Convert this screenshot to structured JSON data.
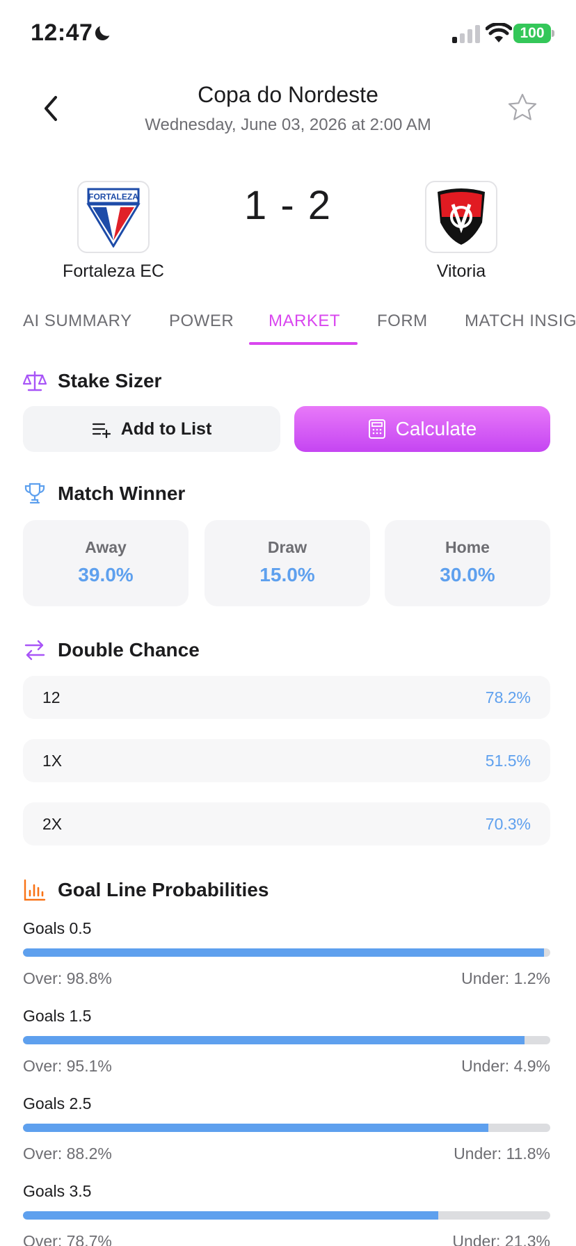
{
  "status_bar": {
    "time": "12:47",
    "battery": "100"
  },
  "header": {
    "title": "Copa do Nordeste",
    "subtitle": "Wednesday, June 03, 2026 at 2:00 AM"
  },
  "match": {
    "home_team": "Fortaleza EC",
    "home_logo_text": "FORTALEZA",
    "away_team": "Vitoria",
    "score": "1 - 2"
  },
  "tabs": [
    {
      "label": "AI SUMMARY"
    },
    {
      "label": "POWER"
    },
    {
      "label": "MARKET"
    },
    {
      "label": "FORM"
    },
    {
      "label": "MATCH INSIG"
    }
  ],
  "stake_sizer": {
    "title": "Stake Sizer",
    "add_label": "Add to List",
    "calc_label": "Calculate"
  },
  "match_winner": {
    "title": "Match Winner",
    "cards": [
      {
        "label": "Away",
        "value": "39.0%"
      },
      {
        "label": "Draw",
        "value": "15.0%"
      },
      {
        "label": "Home",
        "value": "30.0%"
      }
    ]
  },
  "double_chance": {
    "title": "Double Chance",
    "rows": [
      {
        "label": "12",
        "value": "78.2%"
      },
      {
        "label": "1X",
        "value": "51.5%"
      },
      {
        "label": "2X",
        "value": "70.3%"
      }
    ]
  },
  "goal_lines": {
    "title": "Goal Line Probabilities",
    "items": [
      {
        "label": "Goals 0.5",
        "over": "Over: 98.8%",
        "under": "Under: 1.2%",
        "over_pct": 98.8
      },
      {
        "label": "Goals 1.5",
        "over": "Over: 95.1%",
        "under": "Under: 4.9%",
        "over_pct": 95.1
      },
      {
        "label": "Goals 2.5",
        "over": "Over: 88.2%",
        "under": "Under: 11.8%",
        "over_pct": 88.2
      },
      {
        "label": "Goals 3.5",
        "over": "Over: 78.7%",
        "under": "Under: 21.3%",
        "over_pct": 78.7
      }
    ]
  },
  "colors": {
    "accent": "#d946ef",
    "value_blue": "#5ea0ee",
    "battery_green": "#34c759",
    "goal_icon": "#f97316"
  }
}
